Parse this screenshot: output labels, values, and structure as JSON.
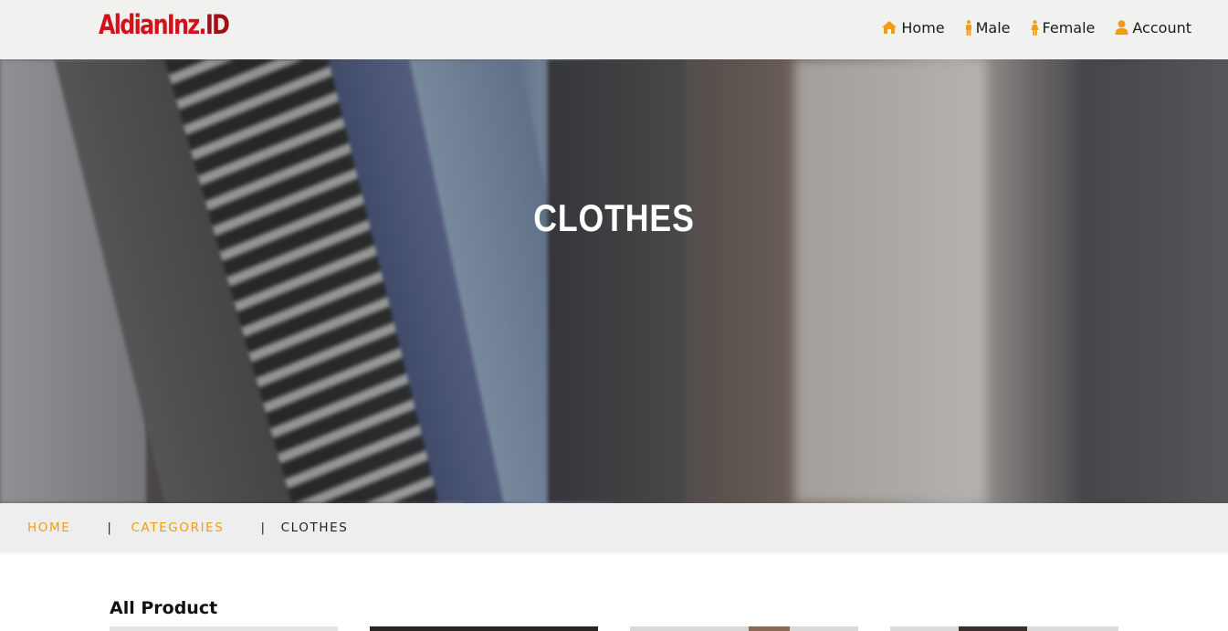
{
  "brand": {
    "name_main": "AldianInz.",
    "name_accent": "ID"
  },
  "nav": {
    "items": [
      {
        "label": "Home",
        "icon": "home-icon"
      },
      {
        "label": "Male",
        "icon": "male-icon"
      },
      {
        "label": "Female",
        "icon": "female-icon"
      },
      {
        "label": "Account",
        "icon": "user-icon"
      }
    ]
  },
  "hero": {
    "title": "CLOTHES"
  },
  "breadcrumb": {
    "home": "HOME",
    "separator": "|",
    "categories": "CATEGORIES",
    "current": "CLOTHES"
  },
  "section": {
    "title": "All Product"
  },
  "colors": {
    "accent": "#f39c12",
    "brand": "#d4101b",
    "nav_bg": "#f1f1ef",
    "breadcrumb_bg": "#eeeeee"
  }
}
